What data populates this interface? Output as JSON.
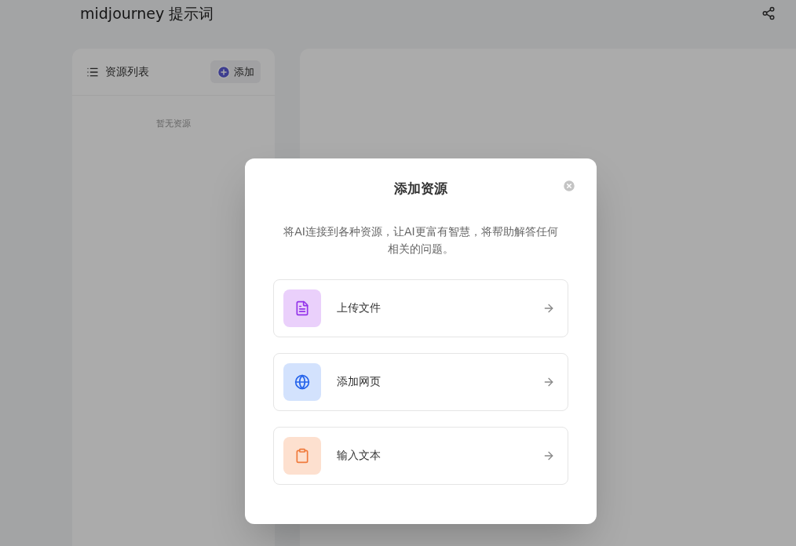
{
  "header": {
    "title": "midjourney 提示词"
  },
  "resource_panel": {
    "title": "资源列表",
    "add_button": "添加",
    "empty_text": "暂无资源"
  },
  "dialog": {
    "title": "添加资源",
    "description": "将AI连接到各种资源，让AI更富有智慧，将帮助解答任何相关的问题。",
    "options": [
      {
        "kind": "file",
        "label": "上传文件"
      },
      {
        "kind": "web",
        "label": "添加网页"
      },
      {
        "kind": "text",
        "label": "输入文本"
      }
    ]
  }
}
